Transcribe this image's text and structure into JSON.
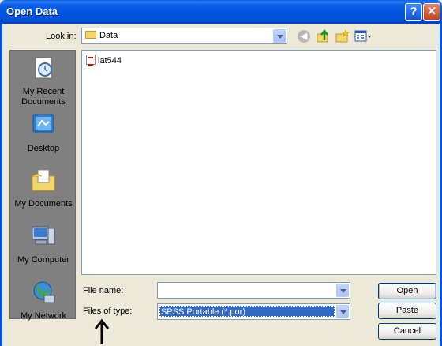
{
  "window": {
    "title": "Open Data",
    "help_label": "?",
    "close_label": "✕"
  },
  "toolbar": {
    "look_in_label": "Look in:",
    "look_in_value": "Data",
    "back_icon": "back-arrow-icon",
    "up_icon": "up-one-level-icon",
    "new_folder_icon": "new-folder-icon",
    "views_icon": "views-menu-icon"
  },
  "places": [
    {
      "label": "My Recent Documents",
      "icon": "recent-documents-icon"
    },
    {
      "label": "Desktop",
      "icon": "desktop-icon"
    },
    {
      "label": "My Documents",
      "icon": "my-documents-icon"
    },
    {
      "label": "My Computer",
      "icon": "my-computer-icon"
    },
    {
      "label": "My Network",
      "icon": "my-network-icon"
    }
  ],
  "files": [
    {
      "name": "lat544",
      "icon": "spss-file-icon"
    }
  ],
  "form": {
    "file_name_label": "File name:",
    "file_name_value": "",
    "files_of_type_label": "Files of type:",
    "files_of_type_value": "SPSS Portable (*.por)"
  },
  "buttons": {
    "open": "Open",
    "paste": "Paste",
    "cancel": "Cancel"
  },
  "colors": {
    "titlebar": "#0054e3",
    "dialog_bg": "#ece9d8",
    "places_bg": "#808080",
    "selection": "#316ac5"
  }
}
